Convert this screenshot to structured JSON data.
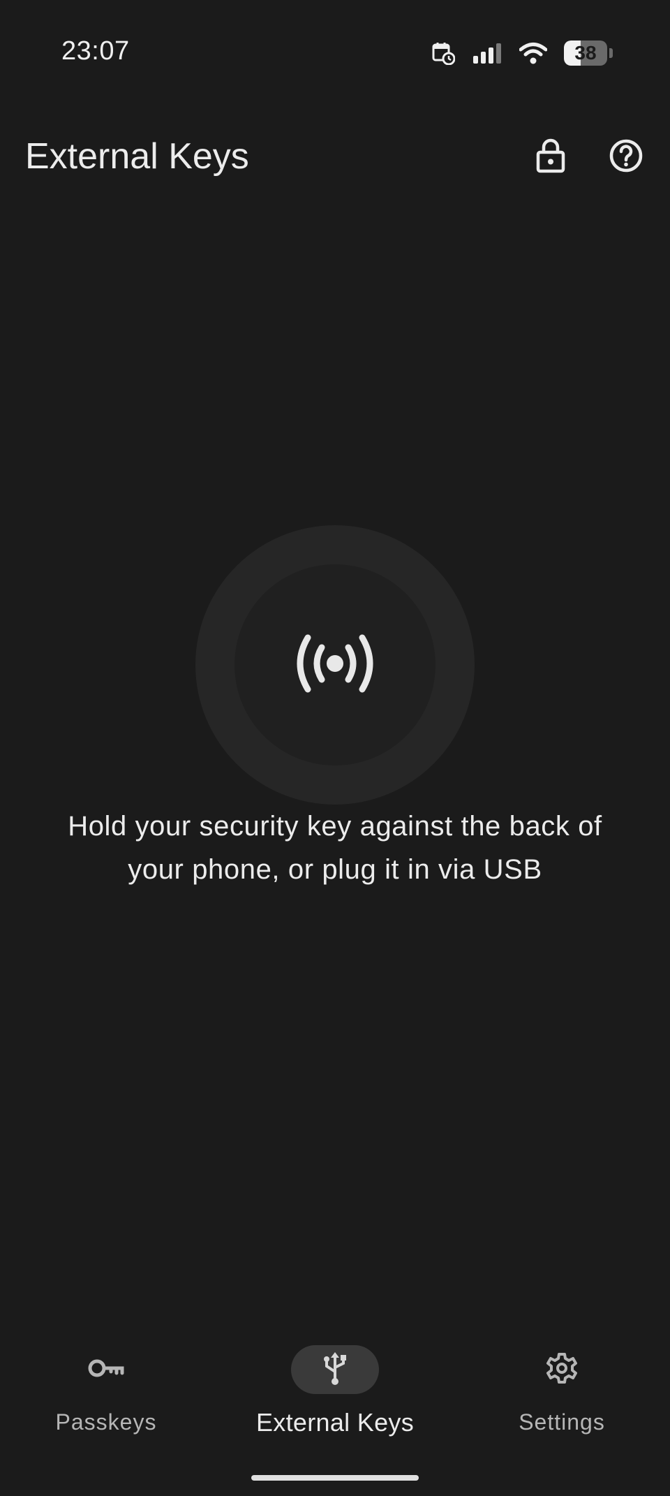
{
  "status_bar": {
    "time": "23:07",
    "battery_level": 38,
    "battery_text": "38",
    "icons": [
      "calendar-clock-icon",
      "signal-icon",
      "wifi-icon",
      "battery-icon"
    ]
  },
  "app_bar": {
    "title": "External Keys",
    "actions": [
      "lock-icon",
      "help-icon"
    ]
  },
  "main": {
    "center_icon": "nfc-broadcast-icon",
    "prompt": "Hold your security key against the back of your phone, or plug it in via USB"
  },
  "bottom_nav": {
    "items": [
      {
        "label": "Passkeys",
        "icon": "key-icon",
        "active": false
      },
      {
        "label": "External Keys",
        "icon": "usb-icon",
        "active": true
      },
      {
        "label": "Settings",
        "icon": "gear-icon",
        "active": false
      }
    ]
  },
  "colors": {
    "background": "#1b1b1b",
    "ring_outer": "#262626",
    "ring_inner": "#202020",
    "active_pill": "#3a3a3a",
    "text_primary": "#ececec",
    "text_secondary": "#b6b6b6"
  }
}
